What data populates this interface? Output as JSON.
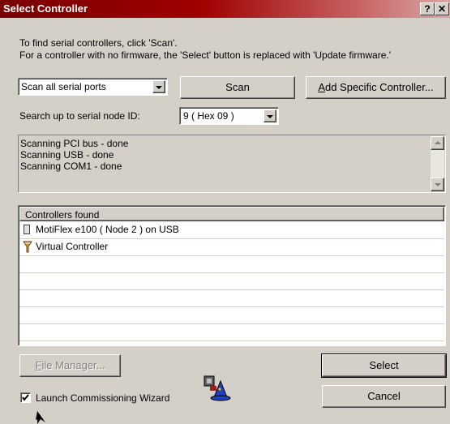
{
  "window": {
    "title": "Select Controller",
    "help_btn": "?",
    "close_btn": "✕"
  },
  "instructions": {
    "line1": "To find serial controllers, click 'Scan'.",
    "line2": "For a controller with no firmware, the 'Select' button is replaced with 'Update firmware.'"
  },
  "port_select": {
    "value": "Scan all serial ports"
  },
  "scan_button": "Scan",
  "add_controller_button": {
    "prefix": "A",
    "rest": "dd Specific Controller..."
  },
  "node_id": {
    "label": "Search up to serial node ID:",
    "value": "9   ( Hex 09 )"
  },
  "log": {
    "lines": [
      "Scanning PCI bus - done",
      "Scanning USB - done",
      "Scanning COM1 - done"
    ]
  },
  "controllers": {
    "header": "Controllers found",
    "items": [
      {
        "label": "MotiFlex e100 ( Node 2 ) on USB",
        "icon": "device-icon"
      },
      {
        "label": "Virtual Controller",
        "icon": "virtual-controller-icon"
      }
    ]
  },
  "file_manager_button": {
    "prefix": "F",
    "rest": "ile Manager..."
  },
  "select_button": "Select",
  "cancel_button": "Cancel",
  "wizard_checkbox": {
    "label": "Launch Commissioning Wizard",
    "checked": true
  },
  "colors": {
    "title_start": "#7a0000",
    "title_end": "#d9a7a7",
    "face": "#d4d0c8"
  }
}
